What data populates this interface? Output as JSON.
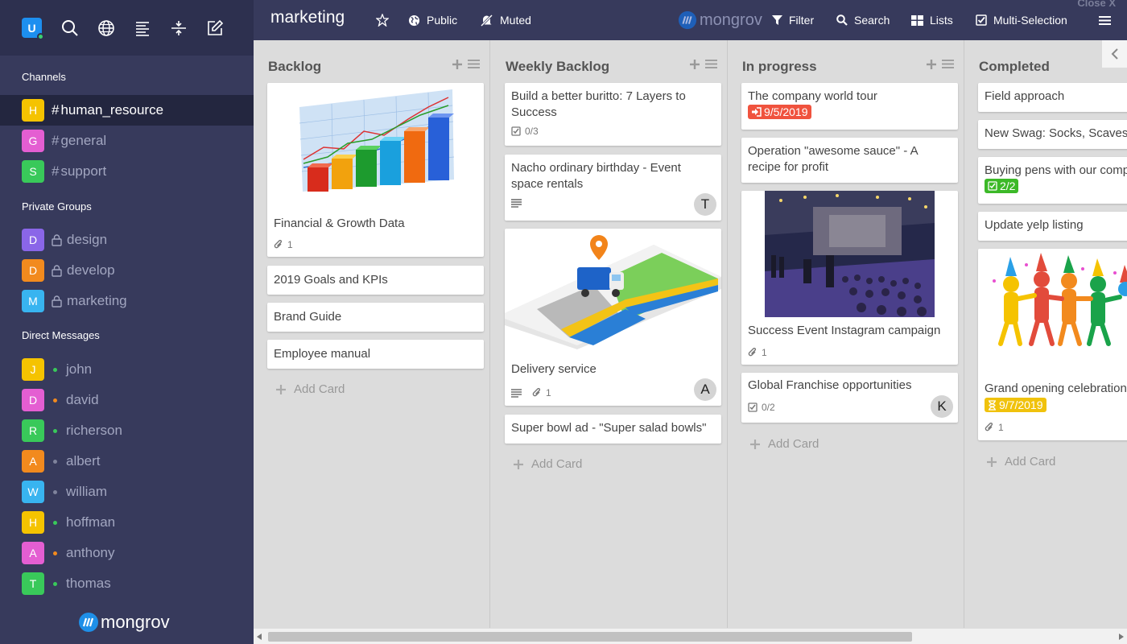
{
  "sidebar": {
    "user_initial": "U",
    "channels_title": "Channels",
    "channels": [
      {
        "letter": "H",
        "name": "human_resource",
        "color": "#f5c300"
      },
      {
        "letter": "G",
        "name": "general",
        "color": "#e45ed2"
      },
      {
        "letter": "S",
        "name": "support",
        "color": "#39c95a"
      }
    ],
    "groups_title": "Private Groups",
    "groups": [
      {
        "letter": "D",
        "name": "design",
        "color": "#8a66e8"
      },
      {
        "letter": "D",
        "name": "develop",
        "color": "#f28a1e"
      },
      {
        "letter": "M",
        "name": "marketing",
        "color": "#38b4f0"
      }
    ],
    "dm_title": "Direct Messages",
    "dms": [
      {
        "letter": "J",
        "name": "john",
        "color": "#f5c300",
        "status": "#39c95a"
      },
      {
        "letter": "D",
        "name": "david",
        "color": "#e45ed2",
        "status": "#f28a1e"
      },
      {
        "letter": "R",
        "name": "richerson",
        "color": "#39c95a",
        "status": "#39c95a"
      },
      {
        "letter": "A",
        "name": "albert",
        "color": "#f28a1e",
        "status": "#7f839c"
      },
      {
        "letter": "W",
        "name": "william",
        "color": "#38b4f0",
        "status": "#7f839c"
      },
      {
        "letter": "H",
        "name": "hoffman",
        "color": "#f5c300",
        "status": "#39c95a"
      },
      {
        "letter": "A",
        "name": "anthony",
        "color": "#e45ed2",
        "status": "#f28a1e"
      },
      {
        "letter": "T",
        "name": "thomas",
        "color": "#39c95a",
        "status": "#39c95a"
      }
    ],
    "logo": "mongrov"
  },
  "topbar": {
    "title": "marketing",
    "public": "Public",
    "muted": "Muted",
    "logo": "mongrov",
    "filter": "Filter",
    "search": "Search",
    "lists": "Lists",
    "multi": "Multi-Selection",
    "close": "Close X"
  },
  "lists": [
    {
      "title": "Backlog",
      "add": "Add Card",
      "cards": [
        {
          "title": "Financial & Growth Data",
          "attach": "1"
        },
        {
          "title": "2019 Goals and KPIs"
        },
        {
          "title": "Brand Guide"
        },
        {
          "title": "Employee manual"
        }
      ]
    },
    {
      "title": "Weekly Backlog",
      "add": "Add Card",
      "cards": [
        {
          "title": "Build a better buritto: 7 Layers to Success",
          "check": "0/3"
        },
        {
          "title": "Nacho ordinary birthday - Event space rentals",
          "avatar": "T"
        },
        {
          "title": "Delivery service",
          "attach": "1",
          "avatar": "A"
        },
        {
          "title": "Super bowl ad - \"Super salad bowls\""
        }
      ]
    },
    {
      "title": "In progress",
      "add": "Add Card",
      "cards": [
        {
          "title": "The company world tour",
          "date": "9/5/2019"
        },
        {
          "title": "Operation \"awesome sauce\" - A recipe for profit"
        },
        {
          "title": "Success Event Instagram campaign",
          "attach": "1"
        },
        {
          "title": "Global Franchise opportunities",
          "check": "0/2",
          "avatar": "K"
        }
      ]
    },
    {
      "title": "Completed",
      "add": "Add Card",
      "cards": [
        {
          "title": "Field approach"
        },
        {
          "title": "New Swag: Socks, Scaves"
        },
        {
          "title": "Buying pens with our comp",
          "check": "2/2"
        },
        {
          "title": "Update yelp listing"
        },
        {
          "title": "Grand opening celebration",
          "date": "9/7/2019",
          "attach": "1"
        }
      ]
    }
  ],
  "colors": {
    "sidebar": "#373a5c",
    "overdue": "#f0533e",
    "done": "#3cb928",
    "due": "#f0c20c"
  }
}
